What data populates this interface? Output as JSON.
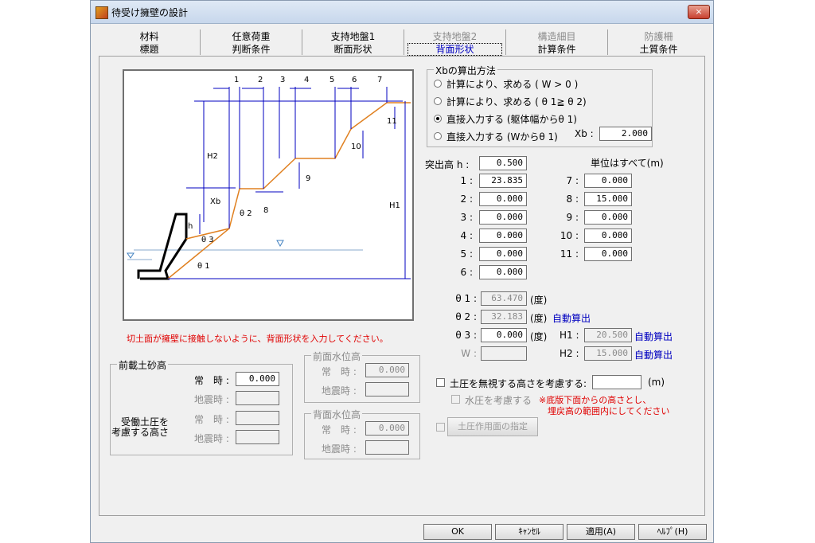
{
  "window": {
    "title": "待受け擁壁の設計",
    "close": "×"
  },
  "tabs_row1": [
    "材料",
    "任意荷重",
    "支持地盤1",
    "支持地盤2",
    "構造細目",
    "防護柵"
  ],
  "tabs_row2": [
    "標題",
    "判断条件",
    "断面形状",
    "背面形状",
    "計算条件",
    "土質条件"
  ],
  "diagram_labels": {
    "n1": "1",
    "n2": "2",
    "n3": "3",
    "n4": "4",
    "n5": "5",
    "n6": "6",
    "n7": "7",
    "n8": "8",
    "n9": "9",
    "n10": "10",
    "n11": "11",
    "H1": "H1",
    "H2": "H2",
    "Xb": "Xb",
    "h": "h",
    "t1": "θ 1",
    "t2": "θ 2",
    "t3": "θ 3"
  },
  "warning": "切土面が擁壁に接触しないように、背面形状を入力してください。",
  "xb_method": {
    "title": "Xbの算出方法",
    "options": [
      "計算により、求める ( W > 0 )",
      "計算により、求める ( θ 1≧ θ 2)",
      "直接入力する (躯体幅からθ 1)",
      "直接入力する (Wからθ 1)"
    ],
    "selected": 2,
    "xb_label": "Xb :",
    "xb_value": "2.000"
  },
  "height": {
    "label": "突出高 h :",
    "value": "0.500",
    "unit_note": "単位はすべて(m)"
  },
  "steps_left": [
    {
      "label": "1 :",
      "value": "23.835"
    },
    {
      "label": "2 :",
      "value": "0.000"
    },
    {
      "label": "3 :",
      "value": "0.000"
    },
    {
      "label": "4 :",
      "value": "0.000"
    },
    {
      "label": "5 :",
      "value": "0.000"
    },
    {
      "label": "6 :",
      "value": "0.000"
    }
  ],
  "steps_right": [
    {
      "label": "7 :",
      "value": "0.000"
    },
    {
      "label": "8 :",
      "value": "15.000"
    },
    {
      "label": "9 :",
      "value": "0.000"
    },
    {
      "label": "10 :",
      "value": "0.000"
    },
    {
      "label": "11 :",
      "value": "0.000"
    }
  ],
  "angles": {
    "t1_label": "θ 1 :",
    "t1_value": "63.470",
    "t1_unit": "(度)",
    "t2_label": "θ 2 :",
    "t2_value": "32.183",
    "t2_unit": "(度)",
    "t2_auto": "自動算出",
    "t3_label": "θ 3 :",
    "t3_value": "0.000",
    "t3_unit": "(度)",
    "w_label": "W :",
    "w_value": ""
  },
  "H": {
    "H1_label": "H1 :",
    "H1_value": "20.500",
    "H1_auto": "自動算出",
    "H2_label": "H2 :",
    "H2_value": "15.000",
    "H2_auto": "自動算出"
  },
  "ignore_soil": {
    "label": "土圧を無視する高さを考慮する:",
    "value": "",
    "unit": "(m)"
  },
  "water_check": "水圧を考慮する",
  "note_line1": "※底版下面からの高さとし、",
  "note_line2": "埋戻高の範囲内にしてください",
  "soil_face_btn": "土圧作用面の指定",
  "front_soil": {
    "title": "前載土砂高",
    "normal_label": "常　時 :",
    "normal_value": "0.000",
    "quake_label": "地震時 :",
    "quake_value": "",
    "side_label1": "受働土圧を",
    "side_label2": "考慮する高さ",
    "normal2_label": "常　時 :",
    "normal2_value": "",
    "quake2_label": "地震時 :",
    "quake2_value": ""
  },
  "front_water": {
    "title": "前面水位高",
    "normal_label": "常　時 :",
    "normal_value": "0.000",
    "quake_label": "地震時 :",
    "quake_value": ""
  },
  "back_water": {
    "title": "背面水位高",
    "normal_label": "常　時 :",
    "normal_value": "0.000",
    "quake_label": "地震時 :",
    "quake_value": ""
  },
  "buttons": {
    "ok": "OK",
    "cancel": "ｷｬﾝｾﾙ",
    "apply": "適用(A)",
    "help": "ﾍﾙﾌﾟ(H)"
  }
}
